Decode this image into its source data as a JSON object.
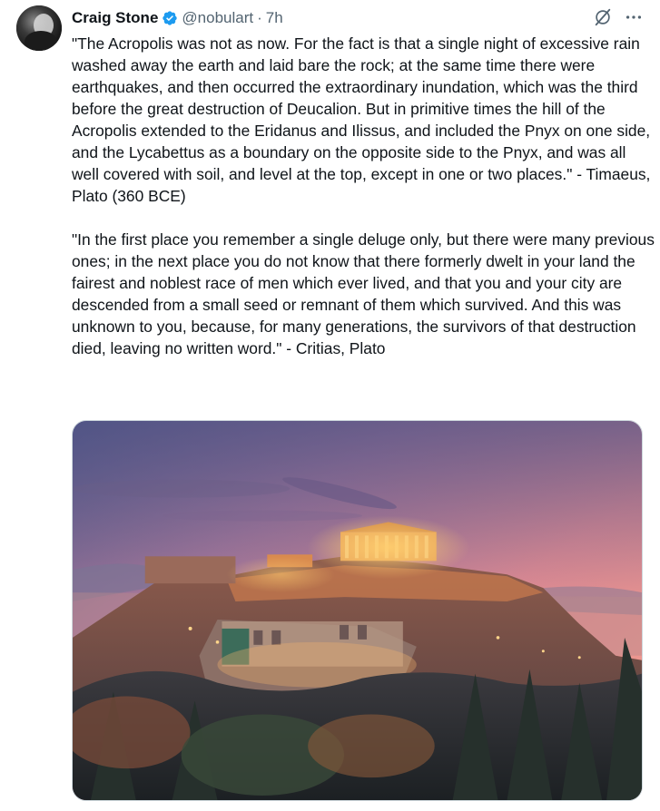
{
  "author": {
    "display_name": "Craig Stone",
    "handle": "@nobulart",
    "separator": "·",
    "time": "7h",
    "verified": true
  },
  "icons": {
    "verified": "verified-badge-icon",
    "grok": "grok-icon",
    "more": "more-options-icon"
  },
  "tweet": {
    "paragraph_1": "\"The Acropolis was not as now. For the fact is that a single night of excessive rain washed away the earth and laid bare the rock; at the same time there were earthquakes, and then occurred the extraordinary inundation, which was the third before the great destruction of Deucalion. But in primitive times the hill of the Acropolis extended to the Eridanus and Ilissus, and included the Pnyx on one side, and the Lycabettus as a boundary on the opposite side to the Pnyx, and was all well covered with soil, and level at the top, except in one or two places.\" - Timaeus, Plato (360 BCE)",
    "paragraph_2": "\"In the first place you remember a single deluge only, but there were many previous ones; in the next place you do not know that there formerly dwelt in your land the fairest and noblest race of men which ever lived, and that you and your city are descended from a small seed or remnant of them which survived. And this was unknown to you, because, for many generations, the survivors of that destruction died, leaving no written word.\" - Critias, Plato"
  },
  "colors": {
    "verified_blue": "#1d9bf0",
    "text": "#0f1419",
    "secondary": "#536471"
  }
}
